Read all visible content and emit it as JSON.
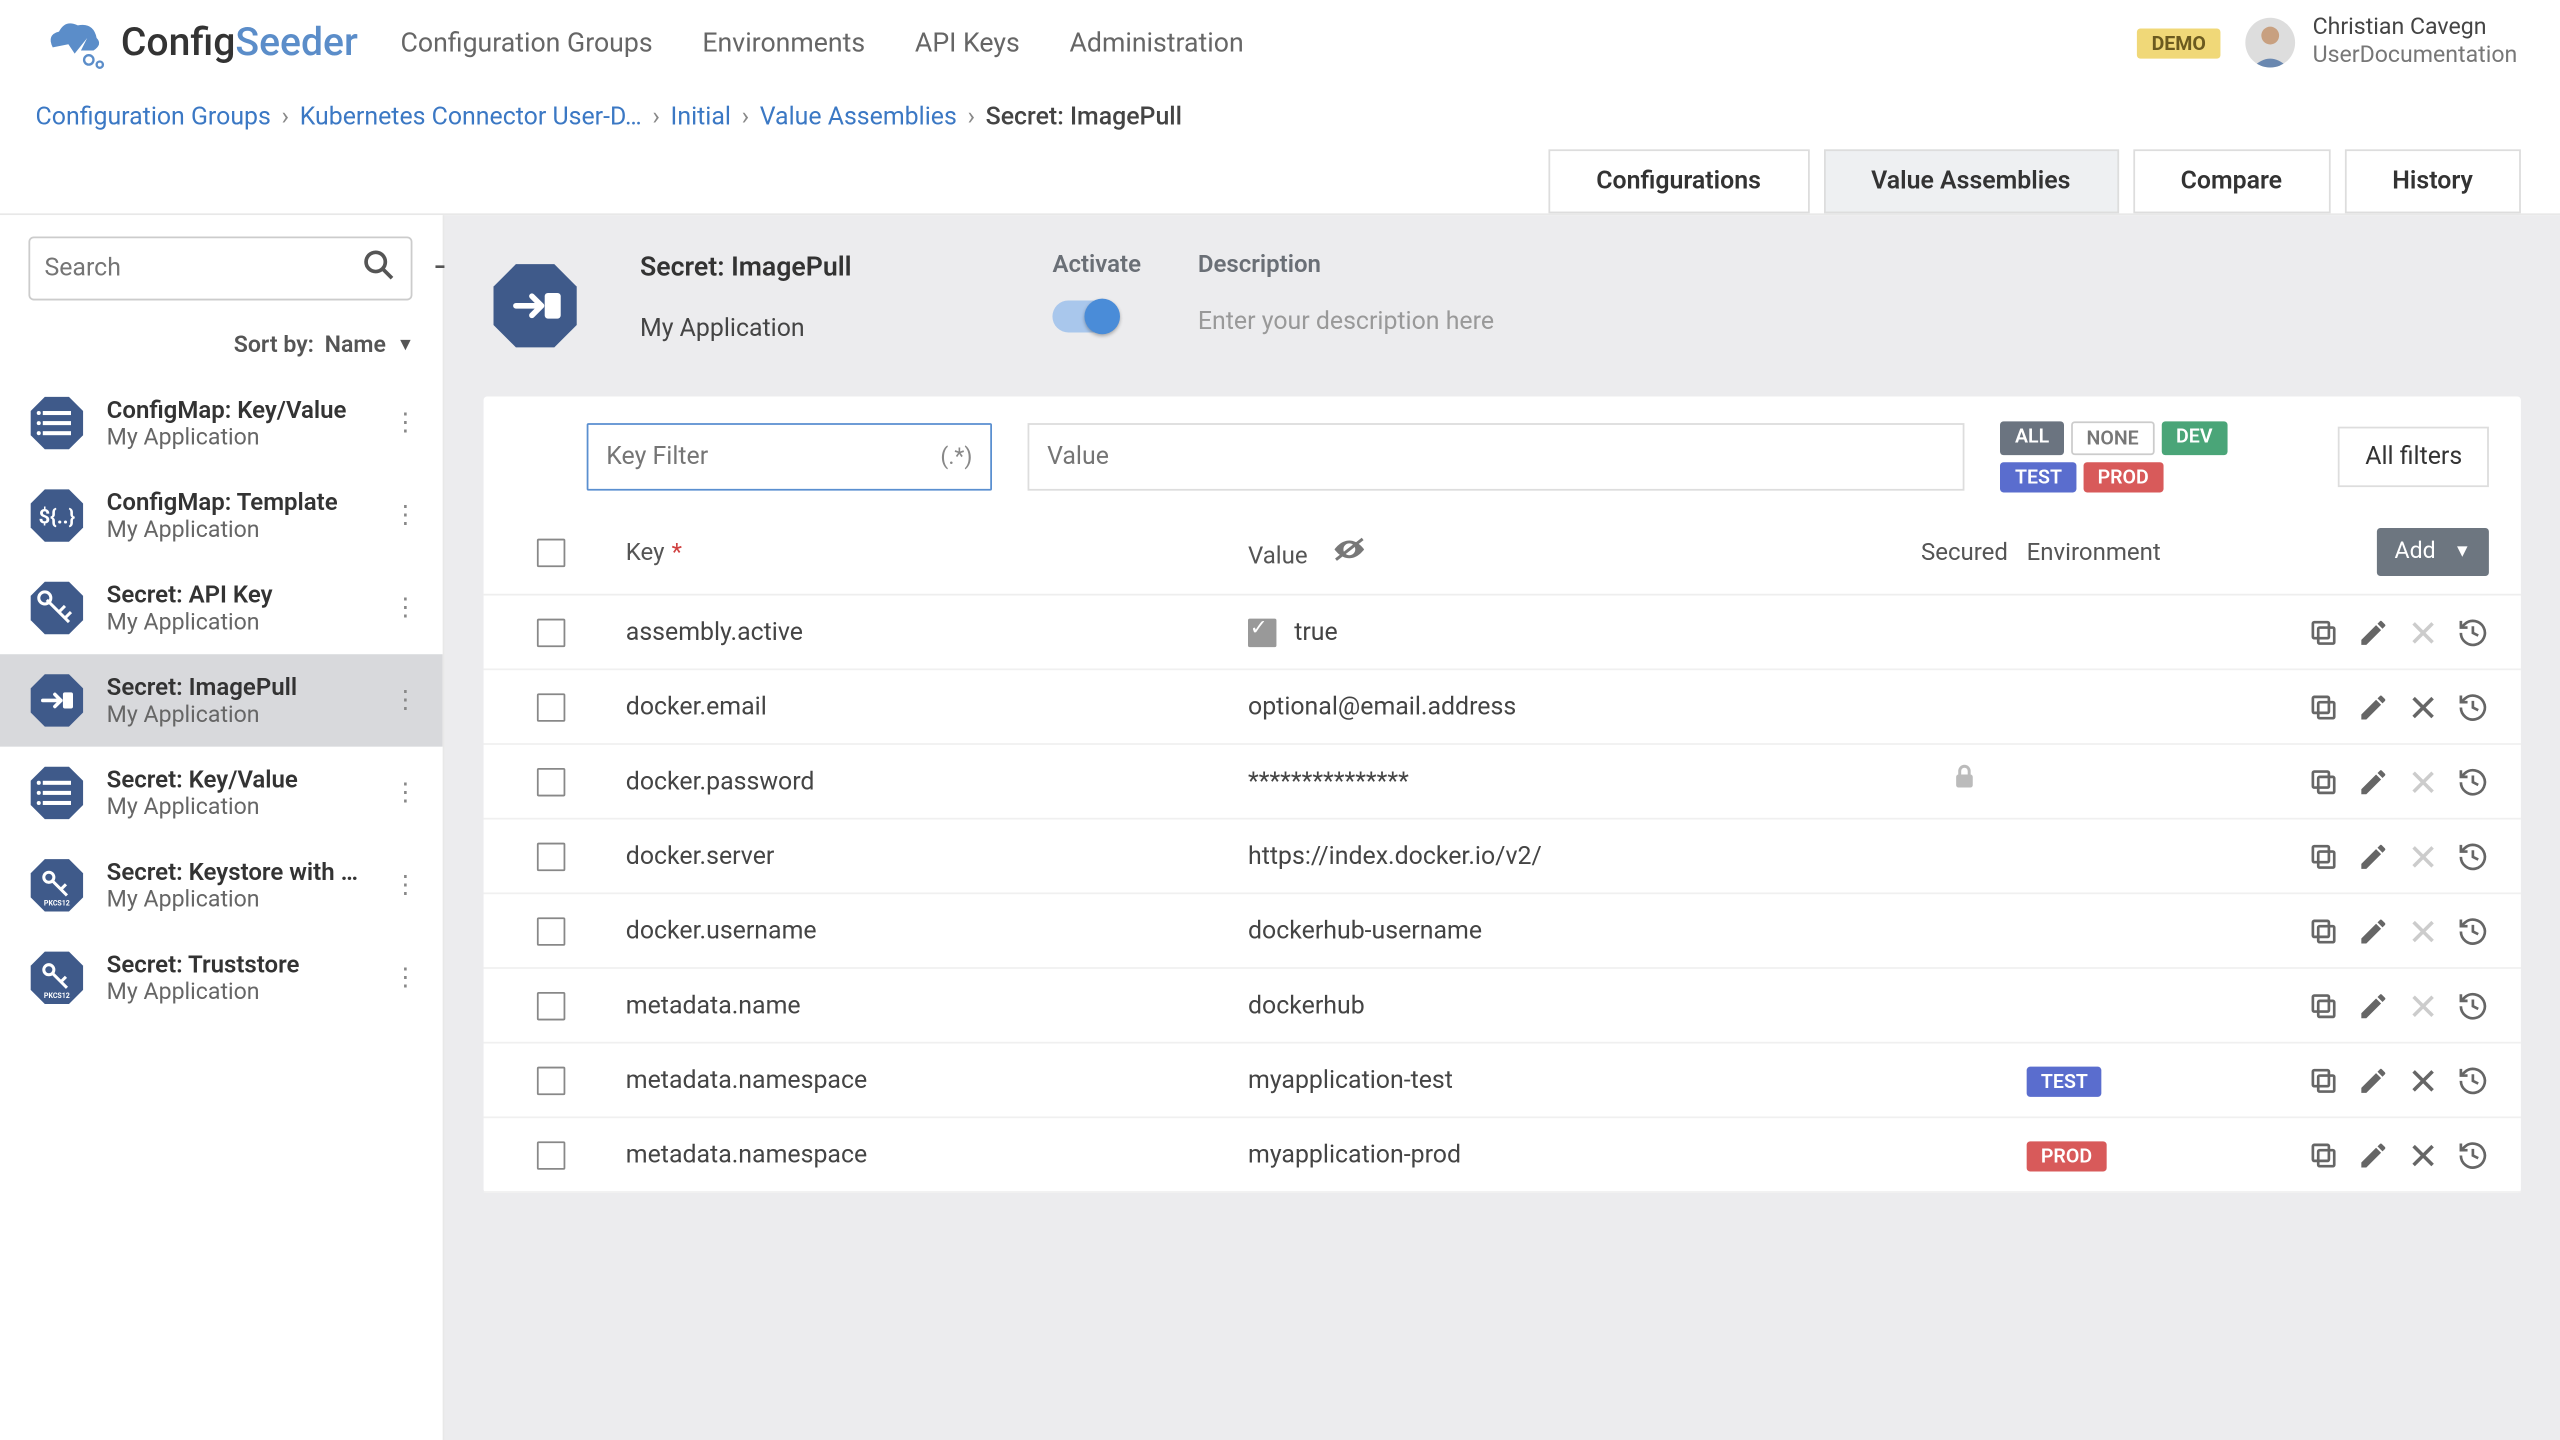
{
  "brand": {
    "name1": "Config",
    "name2": "Seeder"
  },
  "topnav": [
    "Configuration Groups",
    "Environments",
    "API Keys",
    "Administration"
  ],
  "demo_badge": "DEMO",
  "user": {
    "name": "Christian Cavegn",
    "role": "UserDocumentation"
  },
  "breadcrumbs": [
    {
      "label": "Configuration Groups",
      "link": true
    },
    {
      "label": "Kubernetes Connector User-D…",
      "link": true
    },
    {
      "label": "Initial",
      "link": true
    },
    {
      "label": "Value Assemblies",
      "link": true
    },
    {
      "label": "Secret: ImagePull",
      "link": false
    }
  ],
  "tabs": [
    "Configurations",
    "Value Assemblies",
    "Compare",
    "History"
  ],
  "active_tab": 1,
  "sidebar": {
    "search_placeholder": "Search",
    "sort_label": "Sort by:",
    "sort_value": "Name",
    "items": [
      {
        "title": "ConfigMap: Key/Value",
        "sub": "My Application",
        "icon": "list",
        "selected": false
      },
      {
        "title": "ConfigMap: Template",
        "sub": "My Application",
        "icon": "template",
        "selected": false
      },
      {
        "title": "Secret: API Key",
        "sub": "My Application",
        "icon": "key",
        "selected": false
      },
      {
        "title": "Secret: ImagePull",
        "sub": "My Application",
        "icon": "imagepull",
        "selected": true
      },
      {
        "title": "Secret: Key/Value",
        "sub": "My Application",
        "icon": "list",
        "selected": false
      },
      {
        "title": "Secret: Keystore with …",
        "sub": "My Application",
        "icon": "pkcs12",
        "selected": false
      },
      {
        "title": "Secret: Truststore",
        "sub": "My Application",
        "icon": "pkcs12",
        "selected": false
      }
    ]
  },
  "main": {
    "title": "Secret: ImagePull",
    "application": "My Application",
    "activate_label": "Activate",
    "activated": true,
    "description_label": "Description",
    "description_placeholder": "Enter your description here"
  },
  "filters": {
    "key_placeholder": "Key Filter",
    "key_regex_hint": "(.*)",
    "value_placeholder": "Value",
    "env_chips": [
      {
        "label": "ALL",
        "class": "all"
      },
      {
        "label": "NONE",
        "class": "none"
      },
      {
        "label": "DEV",
        "class": "dev"
      },
      {
        "label": "TEST",
        "class": "test"
      },
      {
        "label": "PROD",
        "class": "prod"
      }
    ],
    "all_filters_label": "All filters"
  },
  "table": {
    "headers": {
      "key": "Key",
      "value": "Value",
      "secured": "Secured",
      "environment": "Environment",
      "add": "Add"
    },
    "rows": [
      {
        "key": "assembly.active",
        "value": "true",
        "value_checkbox": true,
        "secured": false,
        "env": null,
        "delete_enabled": false
      },
      {
        "key": "docker.email",
        "value": "optional@email.address",
        "value_checkbox": false,
        "secured": false,
        "env": null,
        "delete_enabled": true
      },
      {
        "key": "docker.password",
        "value": "***************",
        "value_checkbox": false,
        "secured": true,
        "env": null,
        "delete_enabled": false
      },
      {
        "key": "docker.server",
        "value": "https://index.docker.io/v2/",
        "value_checkbox": false,
        "secured": false,
        "env": null,
        "delete_enabled": false
      },
      {
        "key": "docker.username",
        "value": "dockerhub-username",
        "value_checkbox": false,
        "secured": false,
        "env": null,
        "delete_enabled": false
      },
      {
        "key": "metadata.name",
        "value": "dockerhub",
        "value_checkbox": false,
        "secured": false,
        "env": null,
        "delete_enabled": false
      },
      {
        "key": "metadata.namespace",
        "value": "myapplication-test",
        "value_checkbox": false,
        "secured": false,
        "env": "TEST",
        "delete_enabled": true
      },
      {
        "key": "metadata.namespace",
        "value": "myapplication-prod",
        "value_checkbox": false,
        "secured": false,
        "env": "PROD",
        "delete_enabled": true
      }
    ]
  }
}
